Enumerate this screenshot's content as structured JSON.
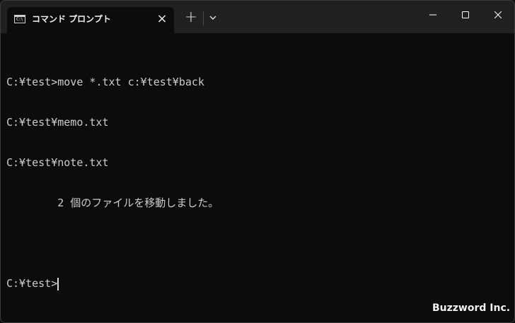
{
  "window": {
    "tab_title": "コマンド プロンプト",
    "tab_icon_glyph": "C:\\",
    "tab_icon_name": "command-prompt-icon",
    "close_tab_icon": "close-icon",
    "new_tab_icon": "plus-icon",
    "dropdown_icon": "chevron-down-icon",
    "minimize_icon": "minimize-icon",
    "maximize_icon": "maximize-icon",
    "close_window_icon": "close-icon"
  },
  "terminal": {
    "lines": [
      "C:¥test>move *.txt c:¥test¥back",
      "C:¥test¥memo.txt",
      "C:¥test¥note.txt",
      "        2 個のファイルを移動しました。",
      "",
      "C:¥test>"
    ]
  },
  "colors": {
    "background": "#0c0c0c",
    "titlebar": "#202020",
    "text": "#cccccc"
  },
  "watermark": "Buzzword Inc."
}
